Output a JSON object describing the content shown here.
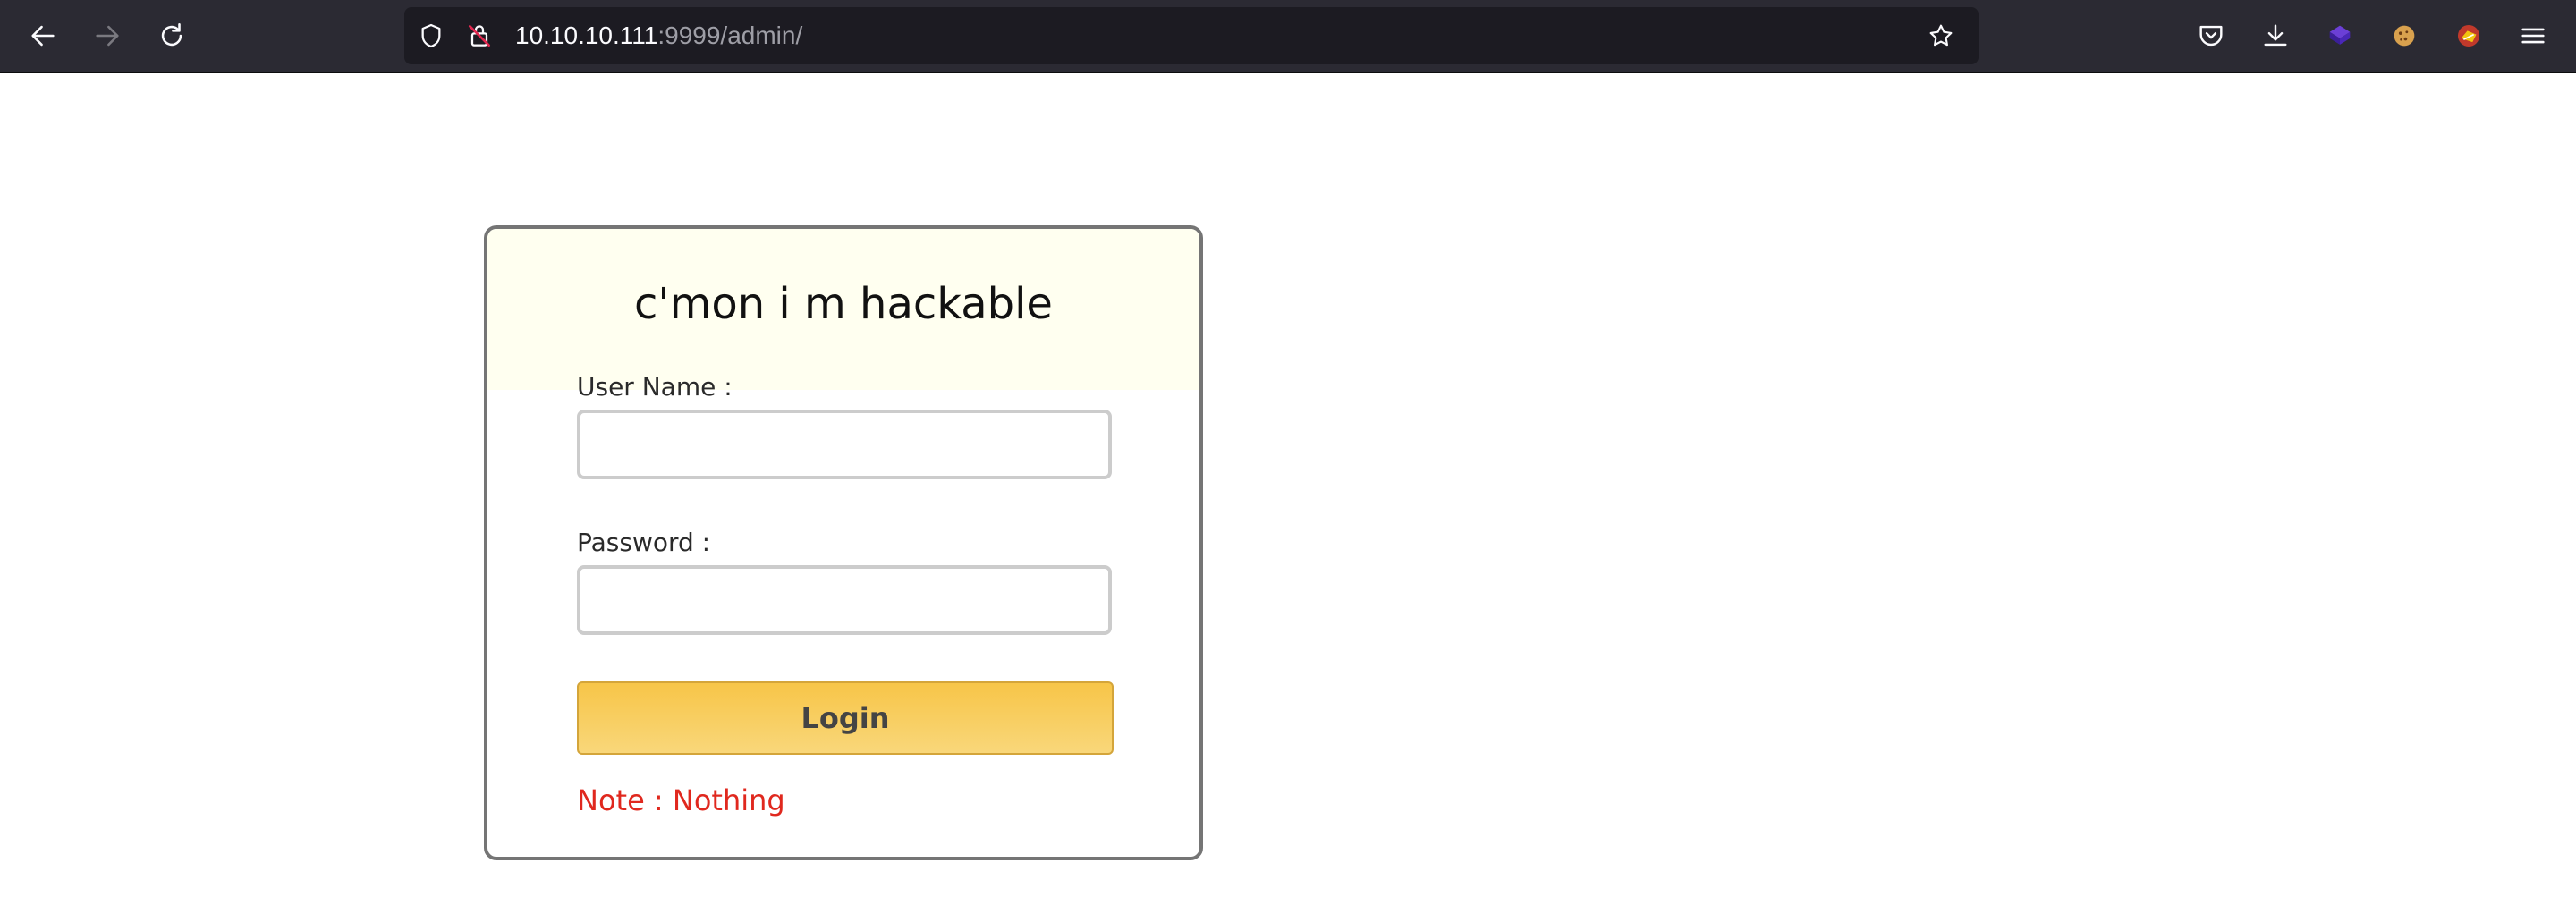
{
  "browser": {
    "url_host": "10.10.10.111",
    "url_rest": ":9999/admin/",
    "icons": [
      "back-arrow-icon",
      "forward-arrow-icon",
      "reload-icon",
      "shield-icon",
      "insecure-lock-icon",
      "bookmark-star-icon",
      "pocket-icon",
      "download-icon",
      "extension-cube-icon",
      "cookie-icon",
      "fox-extension-icon",
      "menu-icon"
    ]
  },
  "login": {
    "title": "c'mon i m hackable",
    "username_label": "User Name :",
    "username_value": "",
    "password_label": "Password :",
    "password_value": "",
    "button_label": "Login",
    "note": "Note : Nothing"
  },
  "colors": {
    "header_bg": "#fffff0",
    "button_top": "#f7c548",
    "note": "#e0281e",
    "chrome": "#2b2a33"
  }
}
